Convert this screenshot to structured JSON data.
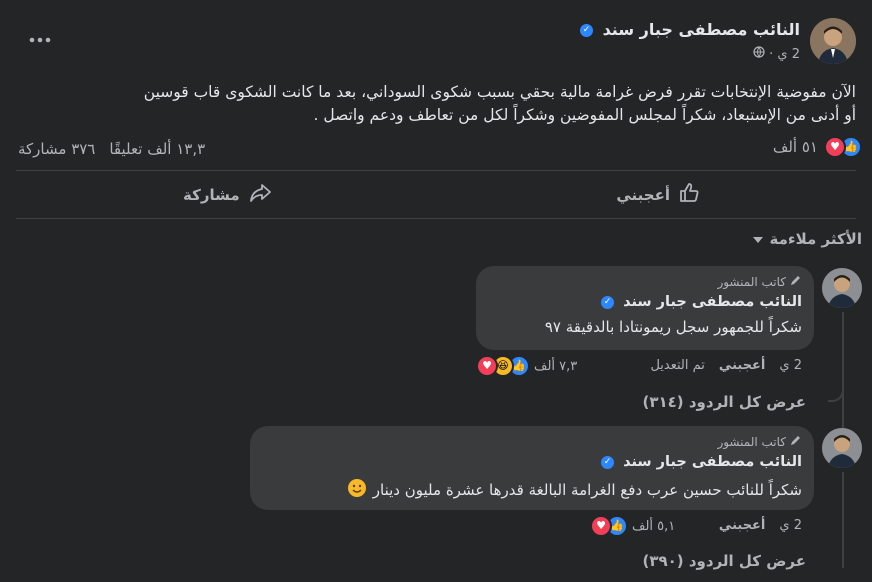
{
  "post": {
    "author": "النائب مصطفى جبار سند",
    "time": "2 ي ·",
    "text_line1": "الآن مفوضية الإنتخابات تقرر فرض غرامة مالية بحقي بسبب شكوى السوداني، بعد ما كانت الشكوى قاب قوسين",
    "text_line2": "أو أدنى من الإستبعاد، شكراً لمجلس المفوضين وشكراً لكل من تعاطف ودعم واتصل .",
    "reactions_count": "٥١ ألف",
    "comments_count": "١٣,٣ ألف تعليقًا",
    "shares_count": "٣٧٦ مشاركة"
  },
  "actions": {
    "like": "أعجبني",
    "share": "مشاركة"
  },
  "sort": {
    "label": "الأكثر ملاءمة"
  },
  "comments": [
    {
      "badge": "كاتب المنشور",
      "author": "النائب مصطفى جبار سند",
      "text": "شكراً للجمهور سجل ريمونتادا بالدقيقة ٩٧",
      "time": "2 ي",
      "like": "أعجبني",
      "edited": "تم التعديل",
      "reactions": "٧,٣ ألف",
      "view_replies": "عرض كل الردود (٣١٤)"
    },
    {
      "badge": "كاتب المنشور",
      "author": "النائب مصطفى جبار سند",
      "text": "شكراً للنائب حسين عرب دفع الغرامة البالغة قدرها عشرة مليون دينار",
      "time": "2 ي",
      "like": "أعجبني",
      "reactions": "٥,١ ألف",
      "view_replies": "عرض كل الردود (٣٩٠)"
    }
  ],
  "icons": {
    "verified": "verified-badge-icon",
    "more": "more-options-icon",
    "globe": "globe-icon",
    "like": "thumbs-up-icon",
    "share": "share-arrow-icon",
    "pencil": "pencil-icon",
    "caret": "caret-down-icon",
    "smiley": "smiley-emoji-icon"
  },
  "colors": {
    "background": "#242526",
    "bubble": "#3a3b3c",
    "accent": "#2d88ff",
    "text": "#e4e6eb",
    "muted": "#b0b3b8"
  }
}
